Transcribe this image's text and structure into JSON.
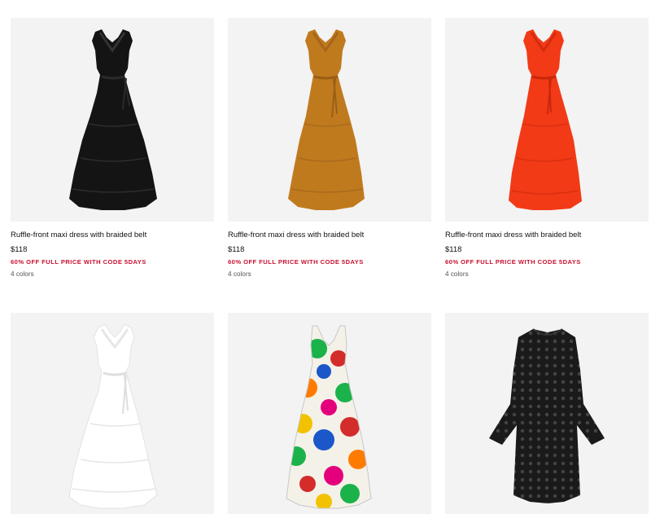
{
  "products": [
    {
      "name": "Ruffle-front maxi dress with braided belt",
      "price": "$118",
      "promo": "60% OFF FULL PRICE WITH CODE 5DAYS",
      "colors": "4 colors",
      "color": "#141414"
    },
    {
      "name": "Ruffle-front maxi dress with braided belt",
      "price": "$118",
      "promo": "60% OFF FULL PRICE WITH CODE 5DAYS",
      "colors": "4 colors",
      "color": "#c07a1e"
    },
    {
      "name": "Ruffle-front maxi dress with braided belt",
      "price": "$118",
      "promo": "60% OFF FULL PRICE WITH CODE 5DAYS",
      "colors": "4 colors",
      "color": "#f23a16"
    },
    {
      "color": "#ffffff"
    },
    {
      "color": "multicolor-floral"
    },
    {
      "color": "#1a1a1a"
    }
  ],
  "promo_color": "#c8102e"
}
